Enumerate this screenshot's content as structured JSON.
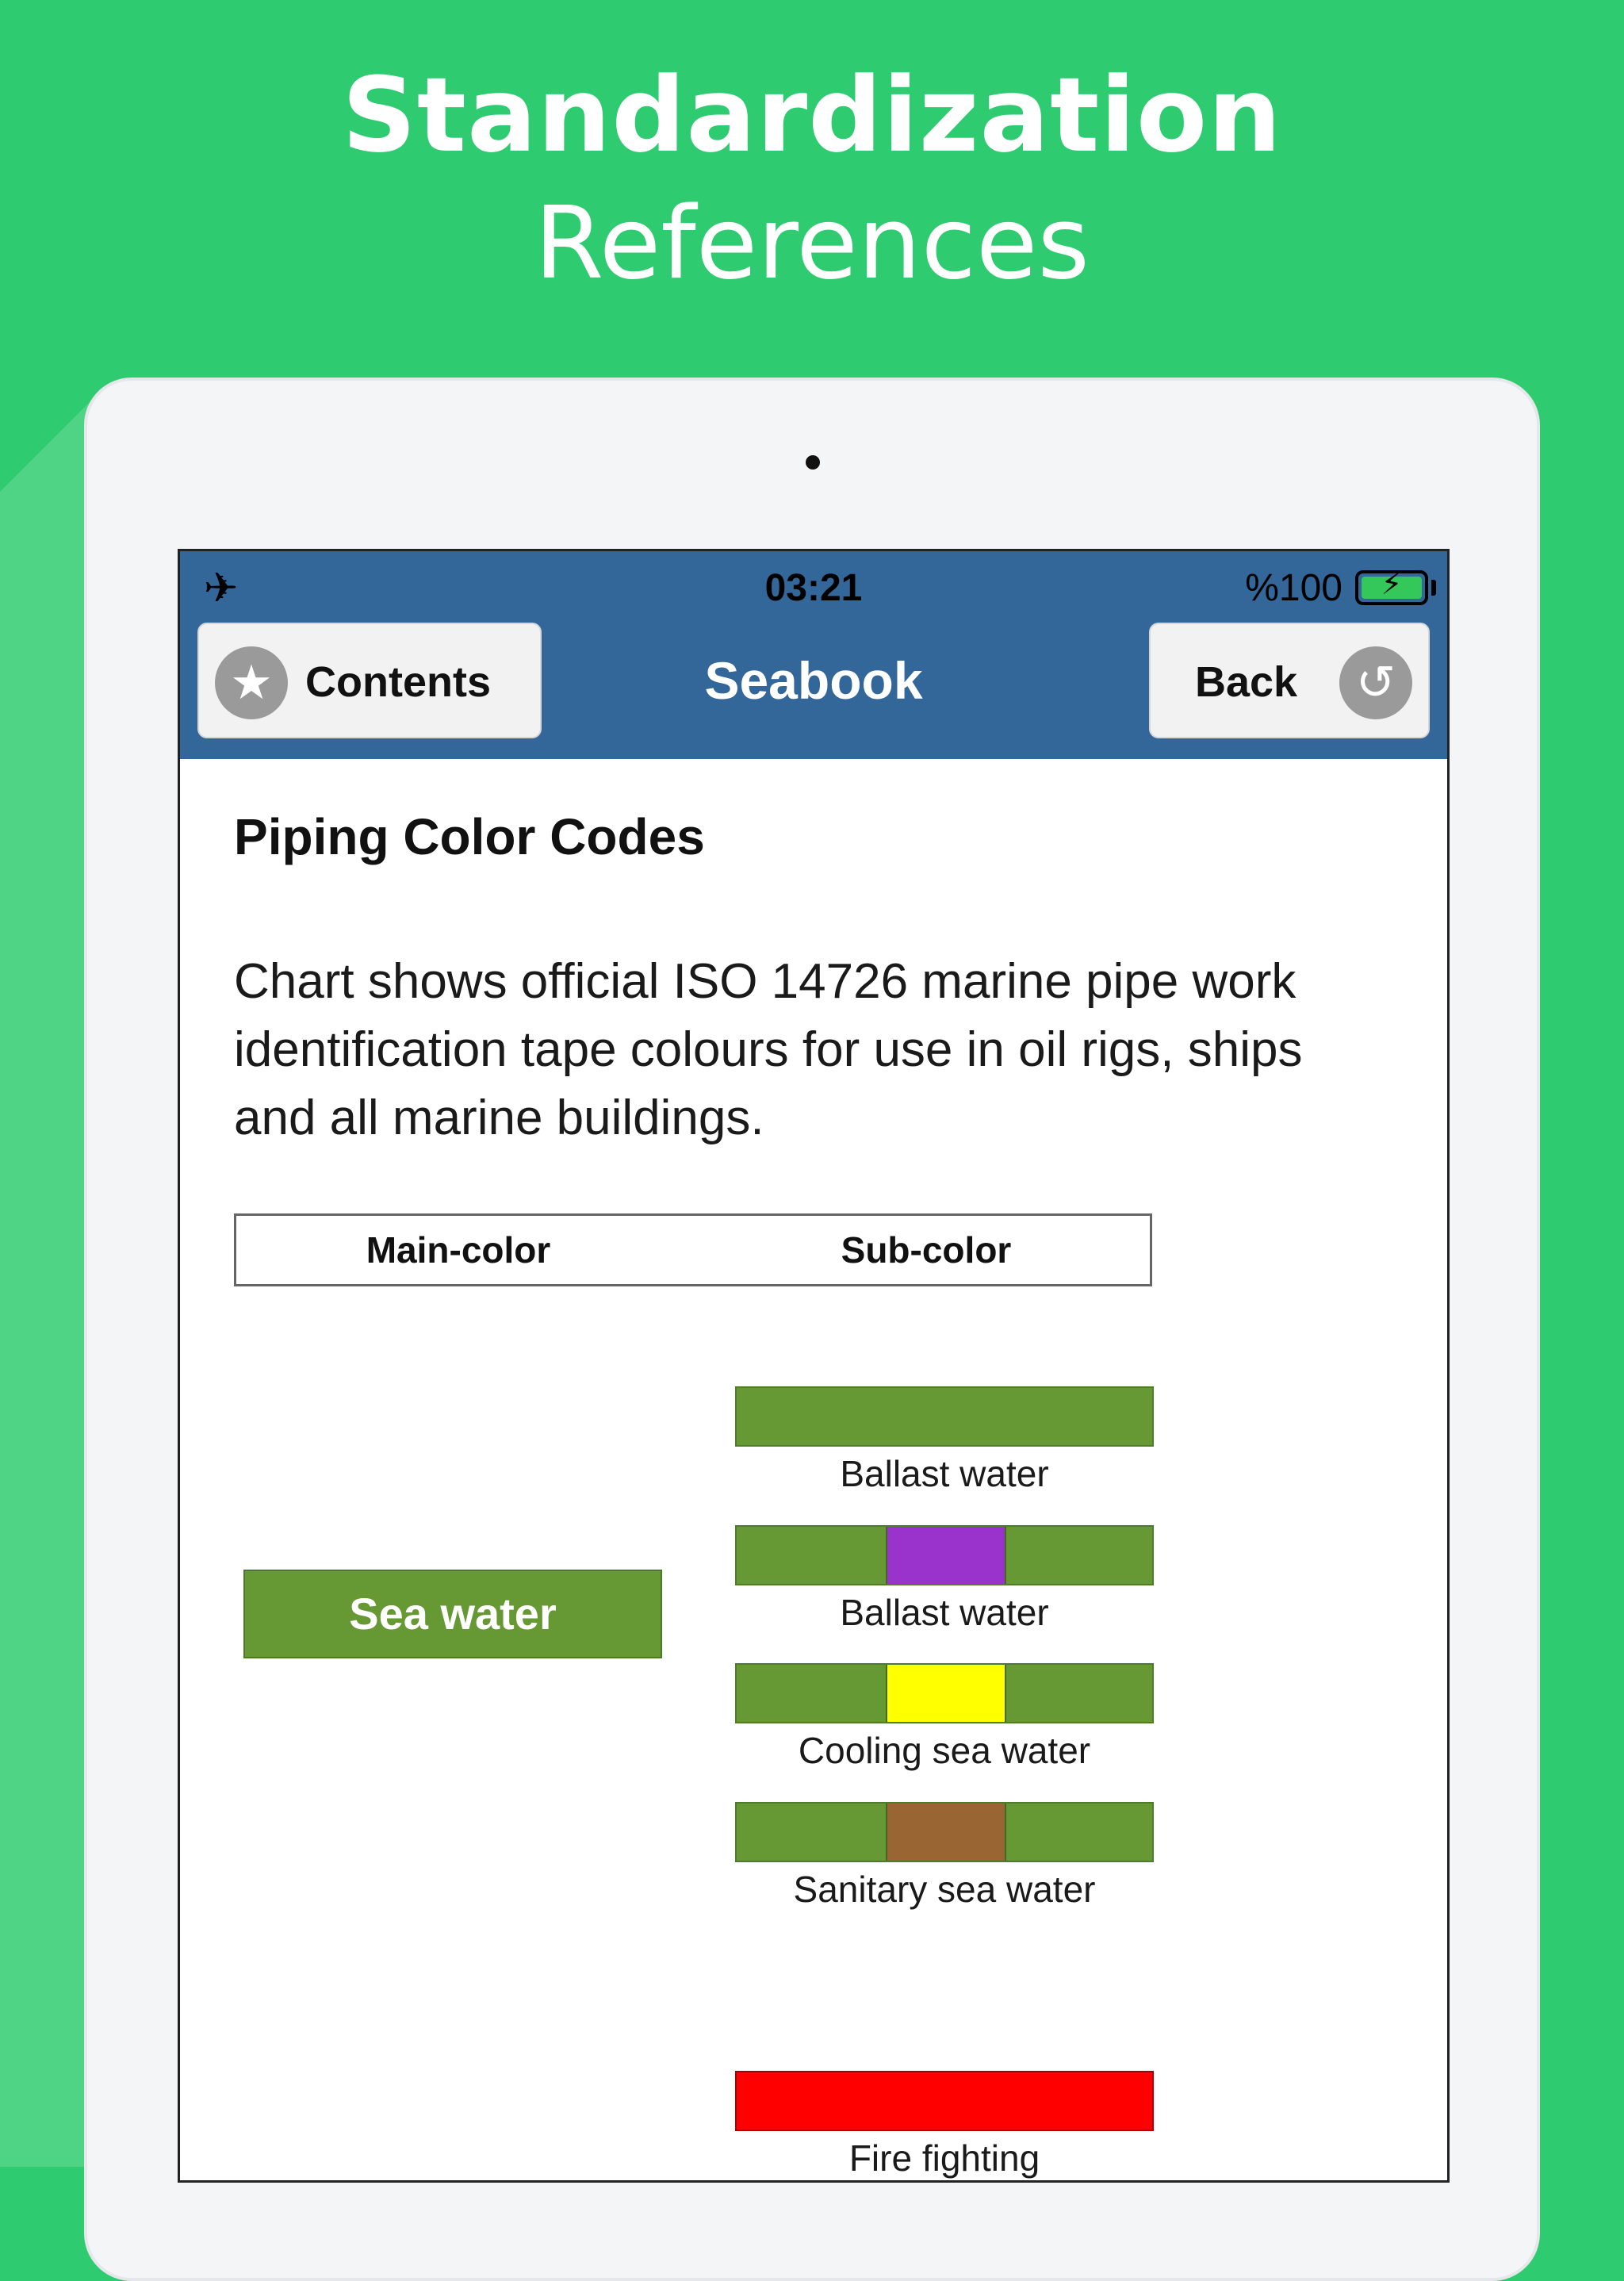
{
  "promo": {
    "title": "Standardization",
    "subtitle": "References"
  },
  "status_bar": {
    "airplane_icon": "airplane-icon",
    "time": "03:21",
    "battery_text": "%100",
    "battery_level": 1.0
  },
  "navbar": {
    "title": "Seabook",
    "contents_label": "Contents",
    "back_label": "Back",
    "contents_icon": "star-icon",
    "back_icon": "undo-arrow-icon"
  },
  "content": {
    "title": "Piping Color Codes",
    "description": "Chart shows official ISO 14726 marine pipe work identification tape colours for use in oil rigs, ships and all marine buildings.",
    "legend": {
      "main": "Main-color",
      "sub": "Sub-color"
    },
    "main_color": {
      "label": "Sea water",
      "color": "#669933"
    },
    "sub_colors": [
      {
        "label": "Ballast water",
        "base": "#669933",
        "stripe": null
      },
      {
        "label": "Ballast water",
        "base": "#669933",
        "stripe": "#9933cc"
      },
      {
        "label": "Cooling sea water",
        "base": "#669933",
        "stripe": "#ffff00"
      },
      {
        "label": "Sanitary sea water",
        "base": "#669933",
        "stripe": "#996633"
      },
      {
        "label": "Fire fighting",
        "base": "#ff0000",
        "stripe": null
      }
    ]
  },
  "colors": {
    "background": "#2fcb70",
    "navbar": "#336699"
  }
}
